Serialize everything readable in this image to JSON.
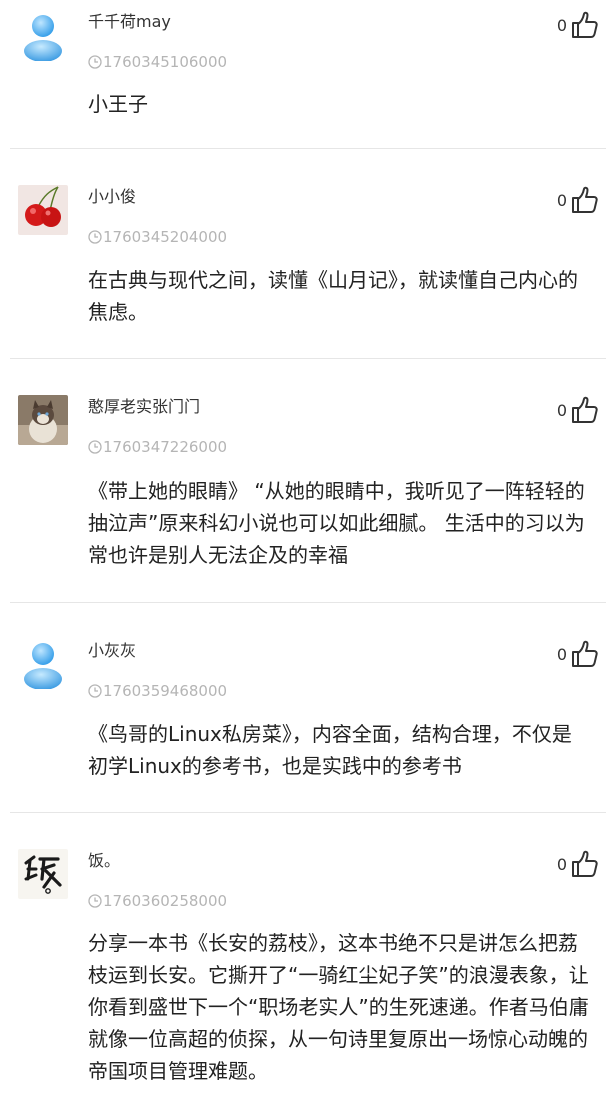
{
  "comments": [
    {
      "username": "千千荷may",
      "time": "1760345106000",
      "likes": "0",
      "content": "小王子",
      "avatar_icon": "default-user-avatar-icon"
    },
    {
      "username": "小小俊",
      "time": "1760345204000",
      "likes": "0",
      "content": "在古典与现代之间，读懂《山月记》，就读懂自己内心的焦虑。",
      "avatar_icon": "cherries-avatar-icon"
    },
    {
      "username": "憨厚老实张门门",
      "time": "1760347226000",
      "likes": "0",
      "content": "《带上她的眼睛》 “从她的眼睛中，我听见了一阵轻轻的抽泣声”原来科幻小说也可以如此细腻。 生活中的习以为常也许是别人无法企及的幸福",
      "avatar_icon": "cat-avatar-icon"
    },
    {
      "username": "小灰灰",
      "time": "1760359468000",
      "likes": "0",
      "content": "《鸟哥的Linux私房菜》，内容全面，结构合理，不仅是初学Linux的参考书，也是实践中的参考书",
      "avatar_icon": "default-user-avatar-icon"
    },
    {
      "username": "饭。",
      "time": "1760360258000",
      "likes": "0",
      "content": "分享一本书《长安的荔枝》，这本书绝不只是讲怎么把荔枝运到长安。它撕开了“一骑红尘妃子笑”的浪漫表象，让你看到盛世下一个“职场老实人”的生死速递。作者马伯庸就像一位高超的侦探，从一句诗里复原出一场惊心动魄的帝国项目管理难题。",
      "avatar_icon": "calligraphy-avatar-icon"
    }
  ],
  "colors": {
    "text": "#222222",
    "meta": "#b5b5b5",
    "divider": "#e6e6e6"
  }
}
